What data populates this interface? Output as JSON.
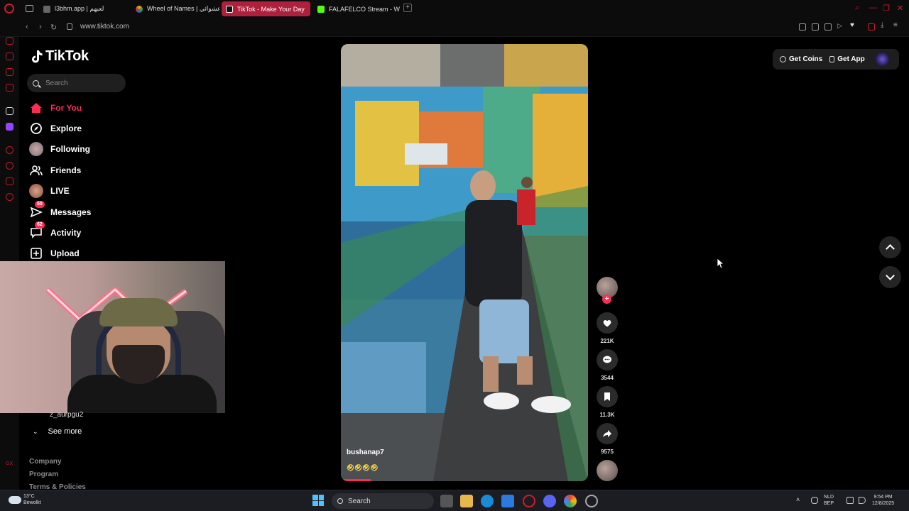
{
  "browser": {
    "tabs": [
      {
        "label": "l3bhm.app | لعبهم",
        "active": false,
        "favicon_color": "#666666"
      },
      {
        "label": "Wheel of Names | عشوائي",
        "active": false,
        "favicon_color": "#e8b400"
      },
      {
        "label": "TikTok - Make Your Day",
        "active": true,
        "favicon_color": "#000000"
      },
      {
        "label": "FALAFELCO Stream - Wa",
        "active": false,
        "favicon_color": "#53fc18"
      }
    ],
    "url": "www.tiktok.com",
    "accent": "#d01b2a"
  },
  "tiktok": {
    "logo_text": "TikTok",
    "search_placeholder": "Search",
    "nav": [
      {
        "label": "For You",
        "icon": "home-icon",
        "active": true
      },
      {
        "label": "Explore",
        "icon": "compass-icon",
        "active": false
      },
      {
        "label": "Following",
        "icon": "following-avatar-icon",
        "active": false
      },
      {
        "label": "Friends",
        "icon": "friends-icon",
        "active": false
      },
      {
        "label": "LIVE",
        "icon": "live-avatar-icon",
        "active": false
      },
      {
        "label": "Messages",
        "icon": "messages-icon",
        "active": false,
        "badge": "50"
      },
      {
        "label": "Activity",
        "icon": "activity-icon",
        "active": false,
        "badge": "62"
      },
      {
        "label": "Upload",
        "icon": "upload-icon",
        "active": false
      }
    ],
    "following_user": "z_aurpgu2",
    "see_more": "See more",
    "footer_links": [
      "Company",
      "Program",
      "Terms & Policies"
    ],
    "get_coins": "Get Coins",
    "get_app": "Get App",
    "brand_color": "#fe2c55"
  },
  "video": {
    "username": "bushanap7",
    "caption_emoji": "🤣🤣🤣🤣",
    "progress": 0.12,
    "likes": "221K",
    "comments": "3544",
    "saves": "11.3K",
    "shares": "9575"
  },
  "taskbar": {
    "weather_temp": "13°C",
    "weather_desc": "Bewolkt",
    "search_label": "Search",
    "lang": "NLD",
    "lang_sub": "BEP",
    "time": "9:54 PM",
    "date": "12/8/2025"
  }
}
